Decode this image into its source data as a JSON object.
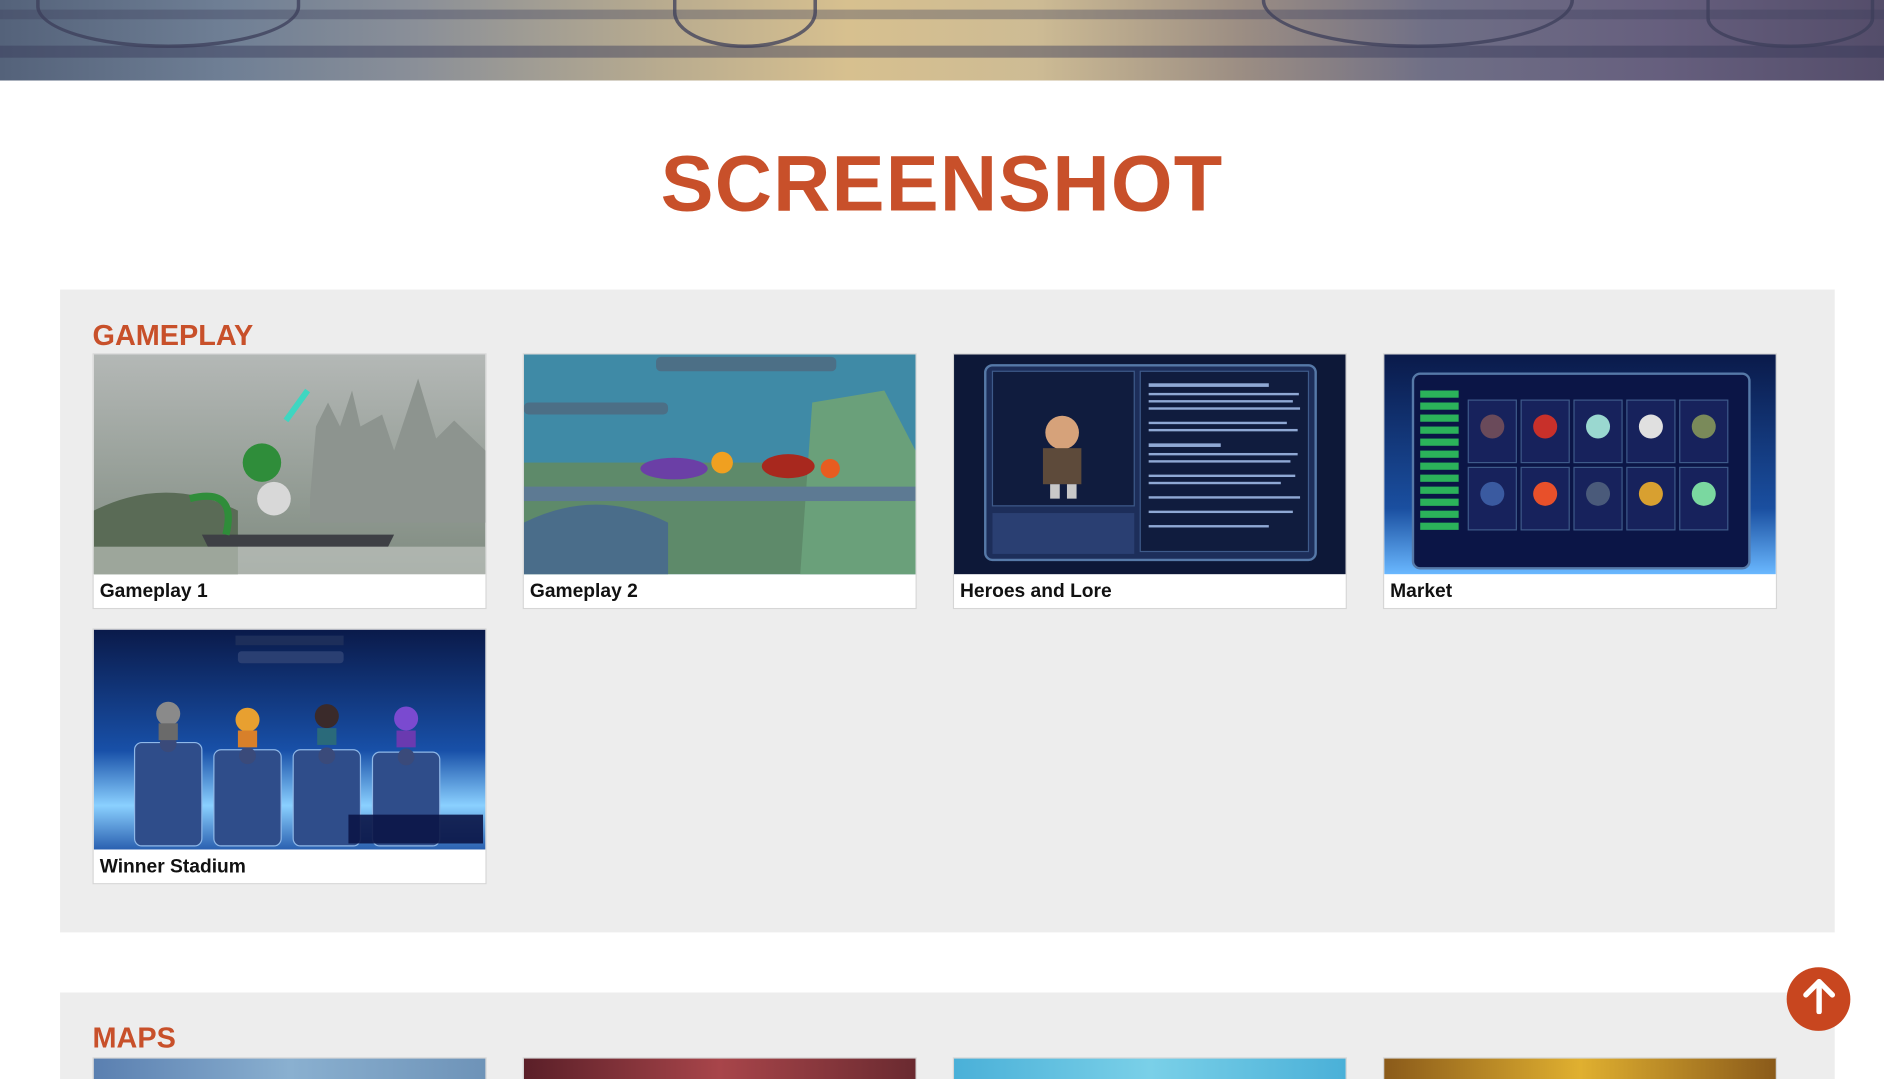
{
  "page": {
    "title": "SCREENSHOT"
  },
  "gameplay": {
    "heading": "GAMEPLAY",
    "items": [
      {
        "caption": "Gameplay 1"
      },
      {
        "caption": "Gameplay 2"
      },
      {
        "caption": "Heroes and Lore"
      },
      {
        "caption": "Market"
      },
      {
        "caption": "Winner Stadium"
      }
    ]
  },
  "maps": {
    "heading": "MAPS"
  },
  "colors": {
    "accent": "#c8502a",
    "panel": "#ededed",
    "button": "#c8461f"
  },
  "icons": {
    "scroll_top": "arrow-up-icon"
  }
}
